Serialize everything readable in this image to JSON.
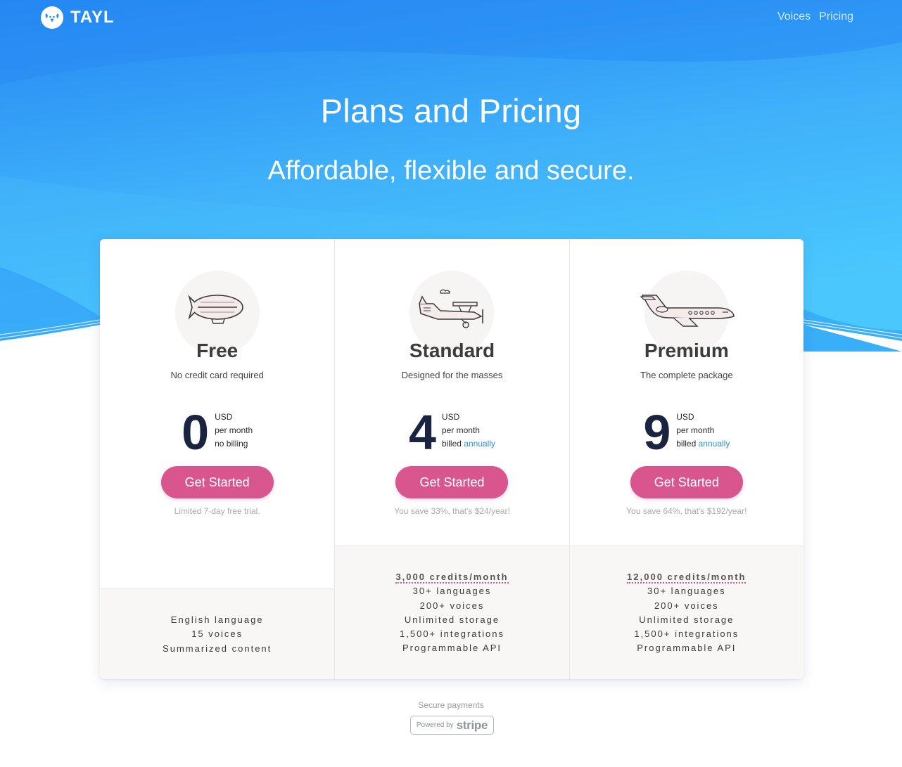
{
  "nav": {
    "logo_text": "TAYL",
    "links": [
      "Voices",
      "Pricing"
    ]
  },
  "hero": {
    "title": "Plans and Pricing",
    "subtitle": "Affordable, flexible and secure."
  },
  "plans": [
    {
      "name": "Free",
      "description": "No credit card required",
      "price": "0",
      "currency": "USD",
      "period": "per month",
      "billing_prefix": "no billing",
      "billing_accent": "",
      "cta": "Get Started",
      "note": "Limited 7-day free trial.",
      "icon": "airship-icon",
      "features": [
        "English language",
        "15 voices",
        "Summarized content"
      ]
    },
    {
      "name": "Standard",
      "description": "Designed for the masses",
      "price": "4",
      "currency": "USD",
      "period": "per month",
      "billing_prefix": "billed",
      "billing_accent": "annually",
      "cta": "Get Started",
      "note": "You save 33%, that's $24/year!",
      "icon": "biplane-icon",
      "credits": "3,000 credits/month",
      "features": [
        "30+ languages",
        "200+ voices",
        "Unlimited storage",
        "1,500+ integrations",
        "Programmable API"
      ]
    },
    {
      "name": "Premium",
      "description": "The complete package",
      "price": "9",
      "currency": "USD",
      "period": "per month",
      "billing_prefix": "billed",
      "billing_accent": "annually",
      "cta": "Get Started",
      "note": "You save 64%, that's $192/year!",
      "icon": "jet-icon",
      "credits": "12,000 credits/month",
      "features": [
        "30+ languages",
        "200+ voices",
        "Unlimited storage",
        "1,500+ integrations",
        "Programmable API"
      ]
    }
  ],
  "footer": {
    "secure_text": "Secure payments",
    "powered_by": "Powered by",
    "stripe": "stripe"
  },
  "colors": {
    "hero_blue": "#2a95f4",
    "hero_light": "#45c3fb",
    "cta_pink": "#d9558e",
    "price_navy": "#1a2440",
    "accent_blue": "#2e8fd8"
  }
}
